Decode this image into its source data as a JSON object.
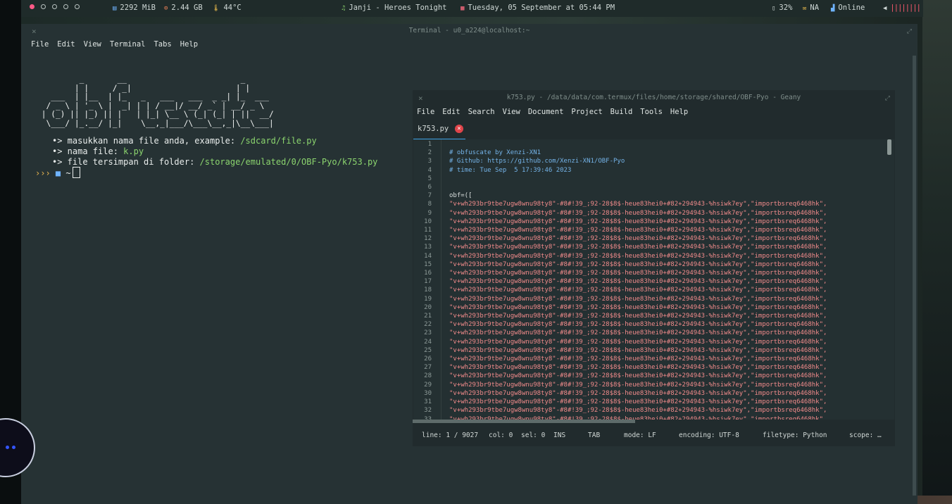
{
  "topbar": {
    "memory": "2292 MiB",
    "storage": "2.44 GB",
    "temp": "44°C",
    "music": "Janji - Heroes Tonight",
    "datetime": "Tuesday, 05 September at 05:44 PM",
    "battery": "32%",
    "mail": "NA",
    "network": "Online"
  },
  "terminal": {
    "title": "Terminal - u0_a224@localhost:~",
    "close_glyph": "×",
    "max_glyph": "⤢",
    "menu": [
      "File",
      "Edit",
      "View",
      "Terminal",
      "Tabs",
      "Help"
    ],
    "ascii_art": "         _       __                        _\n        | |     / _|                      | |\n   ___  | |__  | |_   _   ___   ___  _ _| |_  ___\n  / _ \\ | '_ \\ |  _| | | / __|/ __/ _` | __/ _ \\\n | (_) || |_) || |   | |_| \\__ \\ (_| (_| | ||  __/\n  \\___/ |_.__/ |_|    \\__,_|___/\\___\\__,_|\\__\\___|",
    "lines": [
      {
        "bullet": "•>",
        "text": " masukkan nama file anda, example: ",
        "value": "/sdcard/file.py"
      },
      {
        "bullet": "•>",
        "text": " nama file: ",
        "value": "k.py"
      },
      {
        "bullet": "•>",
        "text": " file tersimpan di folder: ",
        "value": "/storage/emulated/0/OBF-Pyo/k753.py"
      }
    ],
    "prompt": "›››",
    "prompt_dir": "~"
  },
  "geany": {
    "title": "k753.py - /data/data/com.termux/files/home/storage/shared/OBF-Pyo - Geany",
    "menu": [
      "File",
      "Edit",
      "Search",
      "View",
      "Document",
      "Project",
      "Build",
      "Tools",
      "Help"
    ],
    "tab": "k753.py",
    "tab_close": "×",
    "comments": [
      "# obfuscate by Xenzi-XN1",
      "# Github: https://github.com/Xenzi-XN1/OBF-Pyo",
      "# time: Tue Sep  5 17:39:46 2023"
    ],
    "obf_line": "obf=([",
    "string_line": "\"v+wh293br9tbe7ugw8wnu98ty8\"-#8#!39_;92-28$8$-heue83hei0+#82+294943-%hsiwk7ey\",\"importbsreq6468hk\",",
    "status": {
      "line": "line: 1 / 9027",
      "col": "col: 0",
      "sel": "sel: 0",
      "ins": "INS",
      "tab": "TAB",
      "mode": "mode: LF",
      "encoding": "encoding: UTF-8",
      "filetype": "filetype: Python",
      "scope": "scope: …"
    }
  },
  "colors": {
    "accent": "#3fa4e8",
    "string": "#f28b8b",
    "comment": "#74b3e8",
    "terminal_green": "#8bd46e",
    "prompt": "#e6b450"
  }
}
